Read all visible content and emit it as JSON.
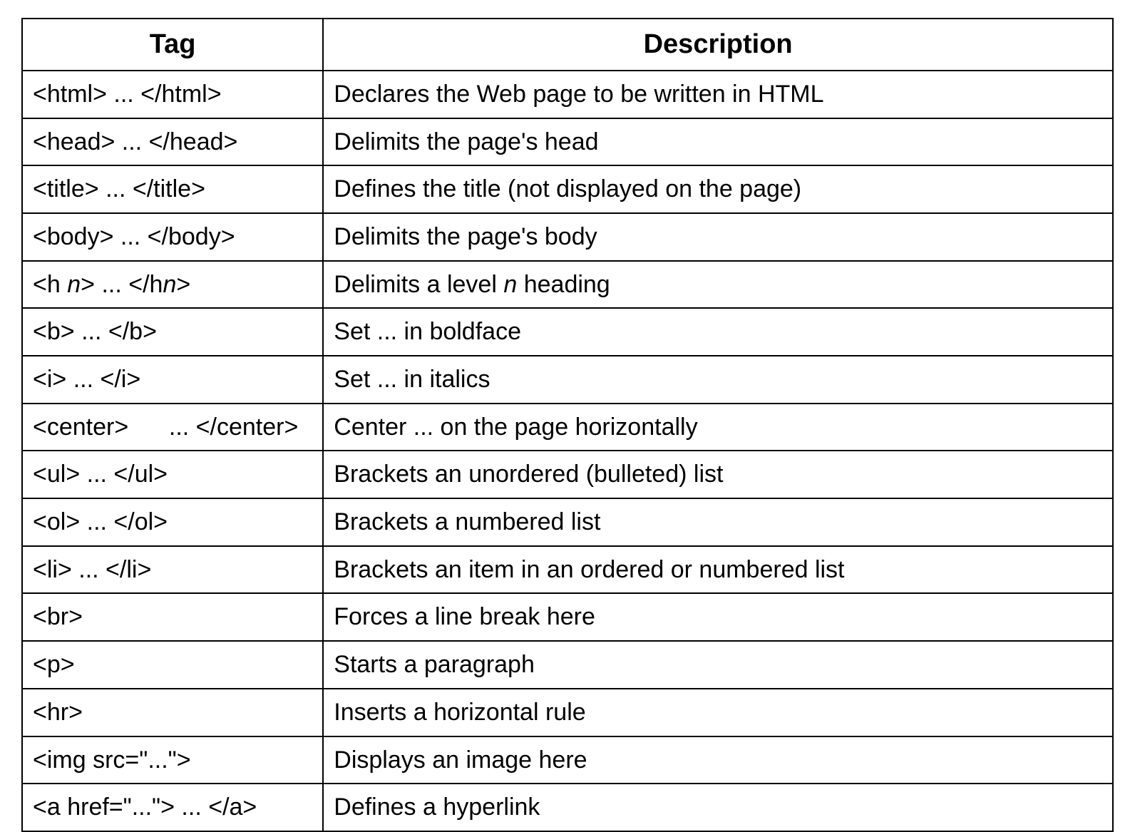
{
  "headers": {
    "tag": "Tag",
    "description": "Description"
  },
  "rows": [
    {
      "tag": "<html> ... </html>",
      "description": "Declares the Web page to be written in HTML"
    },
    {
      "tag": "<head> ... </head>",
      "description": "Delimits the page's head"
    },
    {
      "tag": "<title> ... </title>",
      "description": "Defines the title (not displayed on the page)"
    },
    {
      "tag": "<body> ... </body>",
      "description": "Delimits the page's body"
    },
    {
      "tag_html": "&lt;h <span class=\"italic\">n</span>&gt; ... &lt;/h<span class=\"italic\">n</span>&gt;",
      "desc_html": "Delimits a level <span class=\"italic\">n</span> heading"
    },
    {
      "tag": "<b> ... </b>",
      "description": "Set ... in boldface"
    },
    {
      "tag": "<i> ... </i>",
      "description": "Set ... in italics"
    },
    {
      "tag": "<center>      ... </center>",
      "description": "Center ... on the page horizontally"
    },
    {
      "tag": "<ul> ... </ul>",
      "description": "Brackets an unordered (bulleted) list"
    },
    {
      "tag": "<ol> ... </ol>",
      "description": "Brackets a numbered list"
    },
    {
      "tag": "<li> ... </li>",
      "description": "Brackets an item in an ordered or numbered list"
    },
    {
      "tag": "<br>",
      "description": "Forces a line break here"
    },
    {
      "tag": "<p>",
      "description": "Starts a paragraph"
    },
    {
      "tag": "<hr>",
      "description": "Inserts a horizontal rule"
    },
    {
      "tag": "<img src=\"...\">",
      "description": "Displays an image here"
    },
    {
      "tag": "<a href=\"...\"> ... </a>",
      "description": "Defines a hyperlink"
    }
  ]
}
